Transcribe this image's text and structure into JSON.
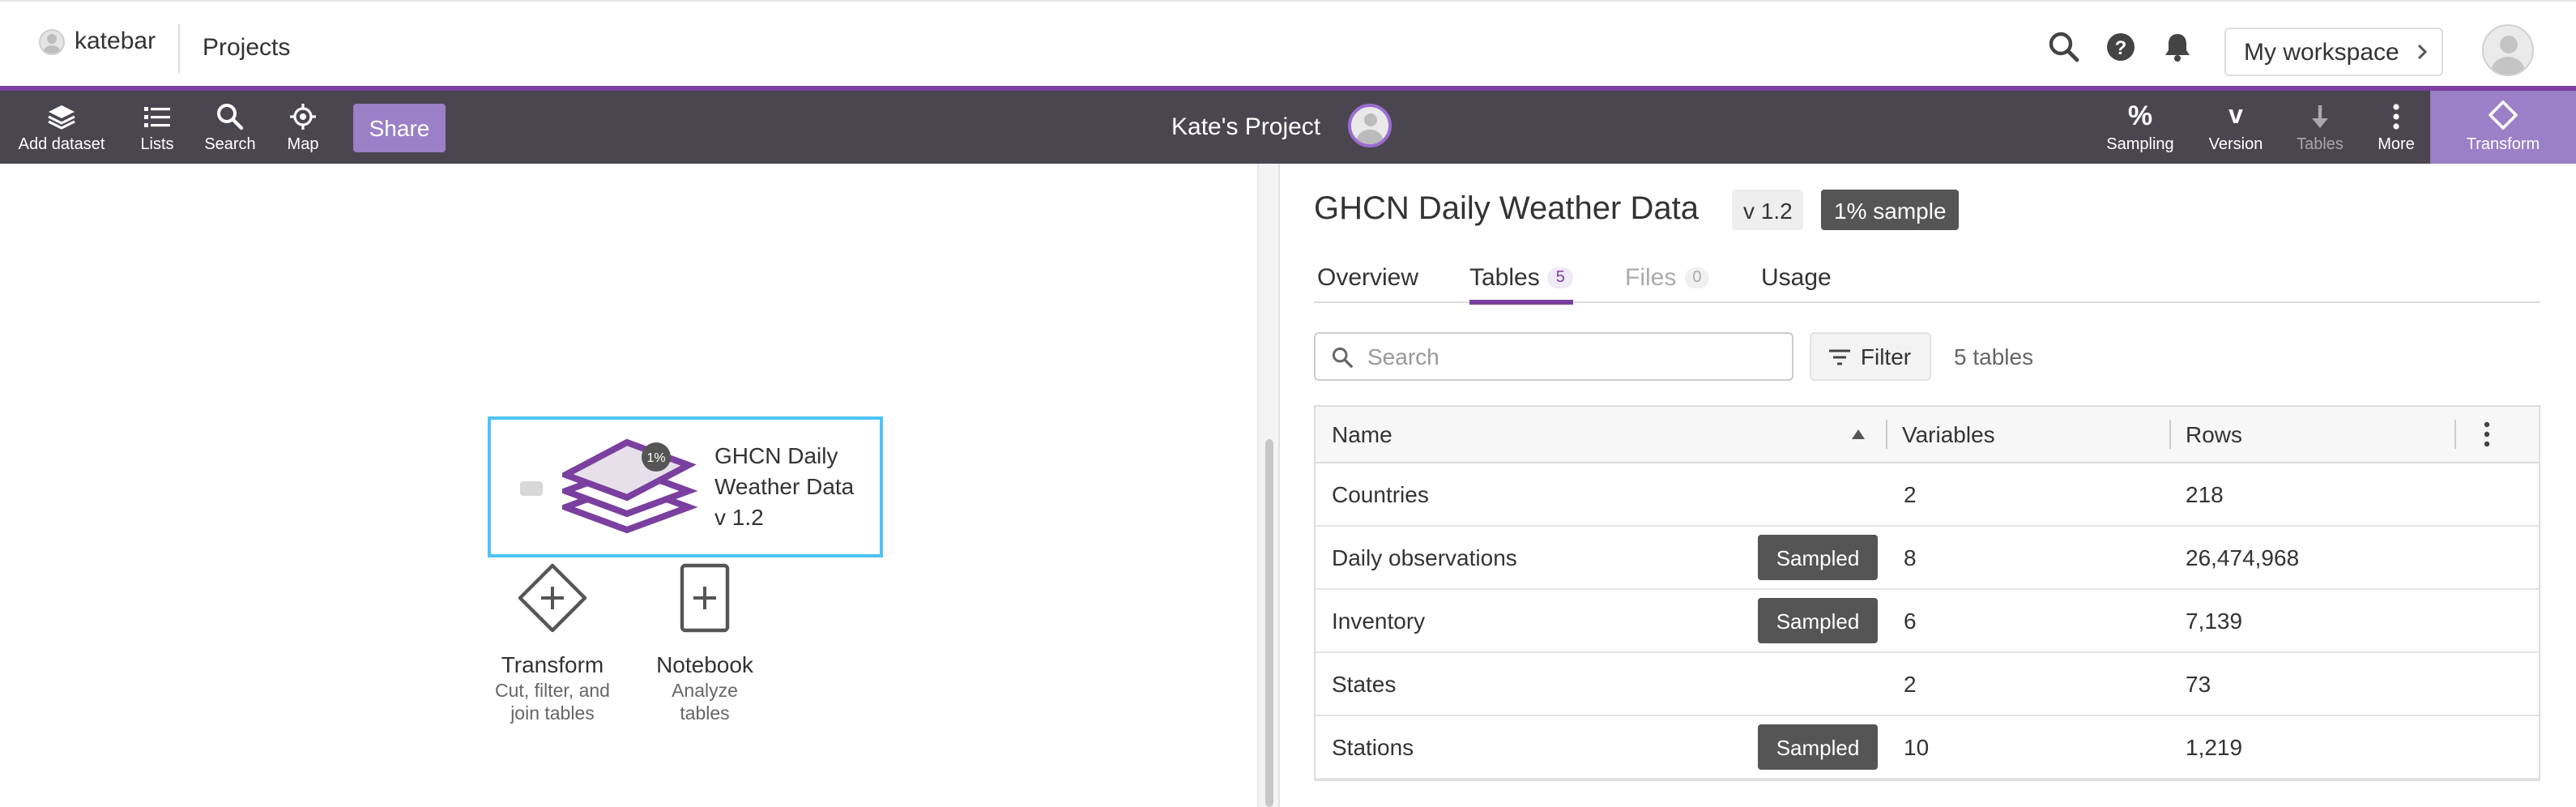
{
  "topbar": {
    "username": "katebar",
    "projects_label": "Projects",
    "workspace_label": "My workspace"
  },
  "toolbar": {
    "left_items": [
      {
        "label": "Add dataset",
        "icon": "layers-icon"
      },
      {
        "label": "Lists",
        "icon": "list-icon"
      },
      {
        "label": "Search",
        "icon": "search-icon"
      },
      {
        "label": "Map",
        "icon": "map-icon"
      }
    ],
    "share_label": "Share",
    "project_title": "Kate's Project",
    "right_items": [
      {
        "label": "Sampling",
        "icon": "percent-icon",
        "glyph": "%"
      },
      {
        "label": "Version",
        "icon": "version-icon",
        "glyph": "v"
      },
      {
        "label": "Tables",
        "icon": "download-arrow-icon",
        "disabled": true
      },
      {
        "label": "More",
        "icon": "more-vertical-icon"
      }
    ],
    "transform_label": "Transform"
  },
  "canvas": {
    "dataset_node": {
      "name_line1": "GHCN Daily",
      "name_line2": "Weather Data",
      "version": "v 1.2",
      "sample_badge": "1%"
    },
    "actions": [
      {
        "title": "Transform",
        "subtitle_line1": "Cut, filter, and",
        "subtitle_line2": "join tables",
        "icon": "transform-diamond-icon"
      },
      {
        "title": "Notebook",
        "subtitle_line1": "Analyze",
        "subtitle_line2": "tables",
        "icon": "notebook-icon"
      }
    ]
  },
  "panel": {
    "title": "GHCN Daily Weather Data",
    "version_tag": "v 1.2",
    "sample_tag": "1% sample",
    "tabs": [
      {
        "label": "Overview"
      },
      {
        "label": "Tables",
        "count": "5",
        "active": true
      },
      {
        "label": "Files",
        "count": "0",
        "disabled": true
      },
      {
        "label": "Usage"
      }
    ],
    "search_placeholder": "Search",
    "filter_label": "Filter",
    "table_count": "5 tables",
    "table": {
      "columns": [
        "Name",
        "Variables",
        "Rows"
      ],
      "sampled_label": "Sampled",
      "rows": [
        {
          "name": "Countries",
          "variables": "2",
          "rows": "218",
          "sampled": false
        },
        {
          "name": "Daily observations",
          "variables": "8",
          "rows": "26,474,968",
          "sampled": true
        },
        {
          "name": "Inventory",
          "variables": "6",
          "rows": "7,139",
          "sampled": true
        },
        {
          "name": "States",
          "variables": "2",
          "rows": "73",
          "sampled": false
        },
        {
          "name": "Stations",
          "variables": "10",
          "rows": "1,219",
          "sampled": true
        }
      ]
    }
  },
  "colors": {
    "toolbar_bg": "#4a4650",
    "accent_purple": "#7b3fa0",
    "button_purple": "#9b7fc7",
    "selection_blue": "#4fc3f7"
  }
}
